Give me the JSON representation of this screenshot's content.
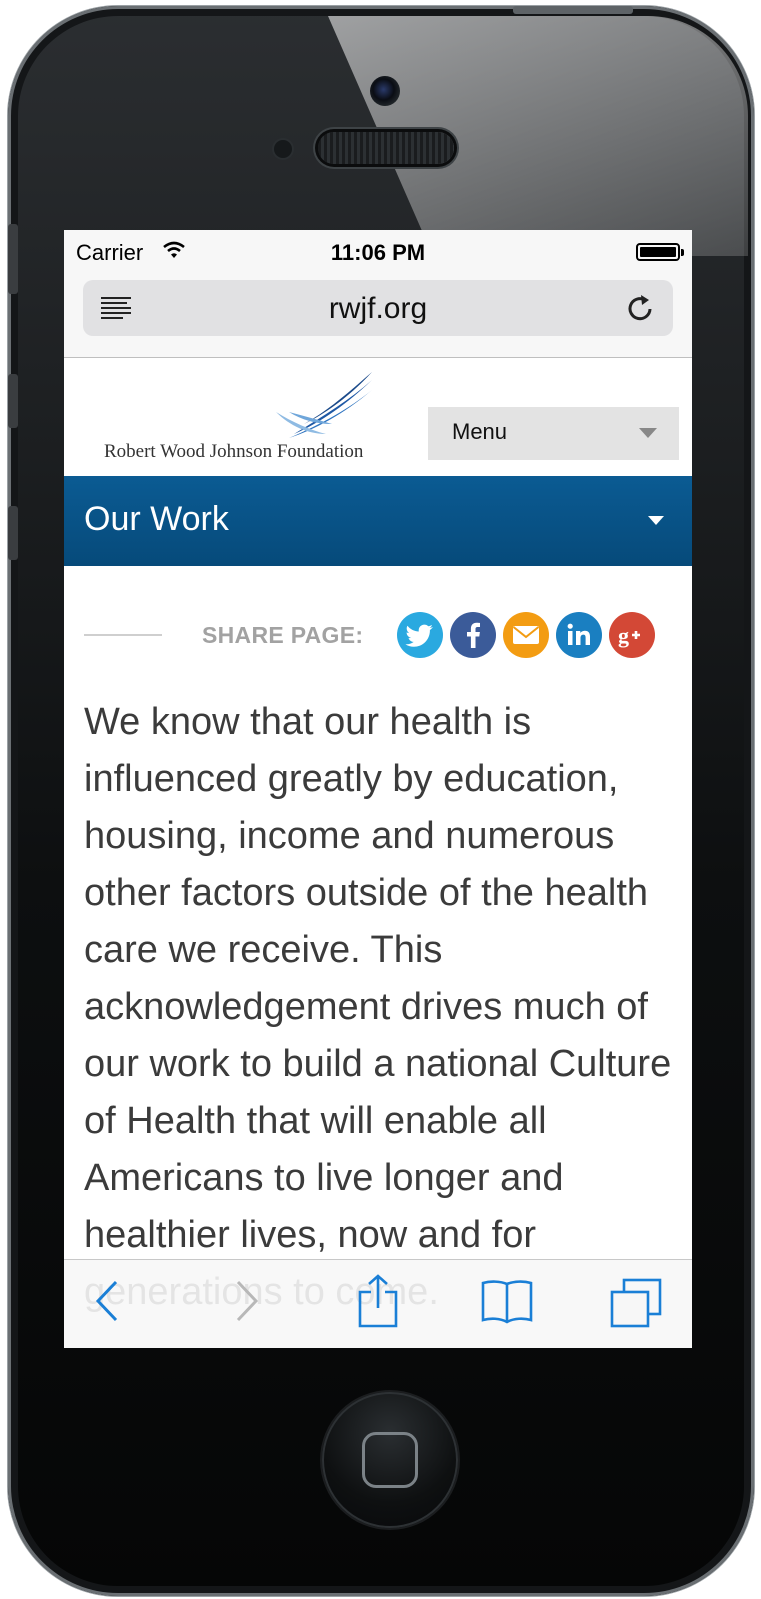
{
  "status_bar": {
    "carrier": "Carrier",
    "time": "11:06 PM"
  },
  "browser": {
    "url": "rwjf.org"
  },
  "site": {
    "logo_text": "Robert Wood Johnson Foundation",
    "menu_label": "Menu",
    "section_title": "Our Work",
    "share_label": "SHARE PAGE:",
    "social_icons": [
      "twitter-icon",
      "facebook-icon",
      "email-icon",
      "linkedin-icon",
      "google-plus-icon"
    ],
    "body_text": "We know that our health is influenced greatly by education, housing, income and numerous other factors outside of the health care we receive. This acknowledgement drives much of our work to build a national Culture of Health that will enable all Americans to live longer and healthier lives, now and for generations to come."
  },
  "colors": {
    "section_bar": "#0b5b93",
    "twitter": "#2aa9e0",
    "facebook": "#3b5b99",
    "email": "#f39c12",
    "linkedin": "#1a7fc1",
    "google_plus": "#d34836",
    "toolbar_active": "#1a7fd6",
    "toolbar_disabled": "#b8b8b8"
  }
}
